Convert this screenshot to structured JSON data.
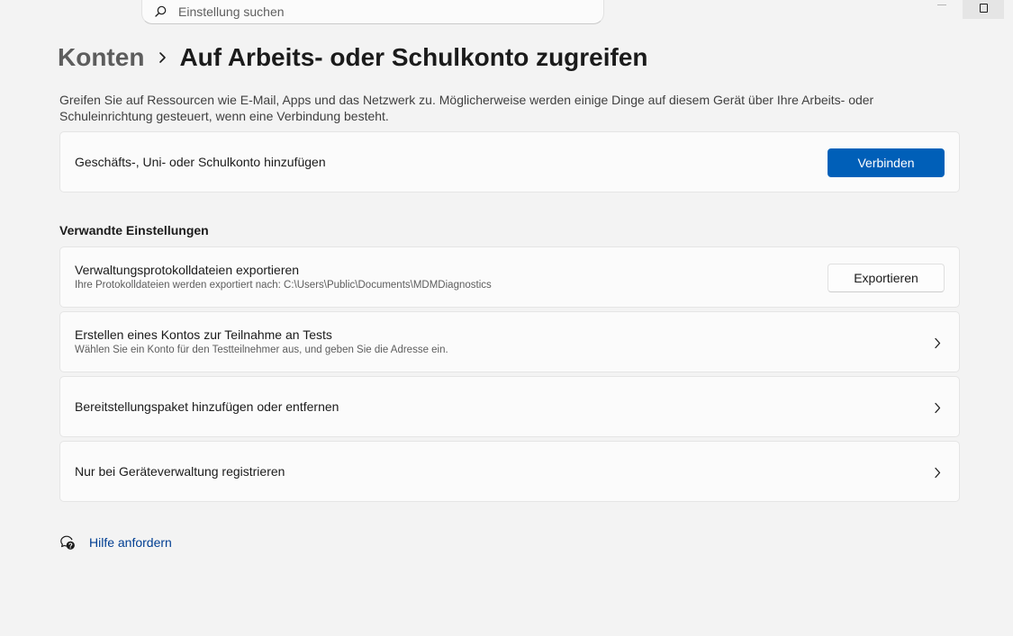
{
  "search": {
    "placeholder": "Einstellung suchen",
    "icon": "search-icon"
  },
  "window_controls": {
    "minimize_icon": "minimize-icon",
    "maximize_icon": "maximize-icon"
  },
  "breadcrumb": {
    "parent": "Konten",
    "separator_icon": "chevron-right-icon",
    "current": "Auf Arbeits- oder Schulkonto zugreifen"
  },
  "description": "Greifen Sie auf Ressourcen wie E-Mail, Apps und das Netzwerk zu. Möglicherweise werden einige Dinge auf diesem Gerät über Ihre Arbeits- oder Schuleinrichtung gesteuert, wenn eine Verbindung besteht.",
  "add_account": {
    "title": "Geschäfts-, Uni- oder Schulkonto hinzufügen",
    "button_label": "Verbinden"
  },
  "related_settings": {
    "heading": "Verwandte Einstellungen",
    "export_logs": {
      "title": "Verwaltungsprotokolldateien exportieren",
      "subtitle": "Ihre Protokolldateien werden exportiert nach: C:\\Users\\Public\\Documents\\MDMDiagnostics",
      "button_label": "Exportieren"
    },
    "test_account": {
      "title": "Erstellen eines Kontos zur Teilnahme an Tests",
      "subtitle": "Wählen Sie ein Konto für den Testteilnehmer aus, und geben Sie die Adresse ein."
    },
    "provisioning_package": {
      "title": "Bereitstellungspaket hinzufügen oder entfernen"
    },
    "device_management": {
      "title": "Nur bei Geräteverwaltung registrieren"
    }
  },
  "help": {
    "label": "Hilfe anfordern",
    "icon": "help-chat-icon"
  },
  "colors": {
    "accent": "#005fb8",
    "link": "#003e92",
    "background": "#f3f3f3",
    "card": "#fbfbfb"
  }
}
